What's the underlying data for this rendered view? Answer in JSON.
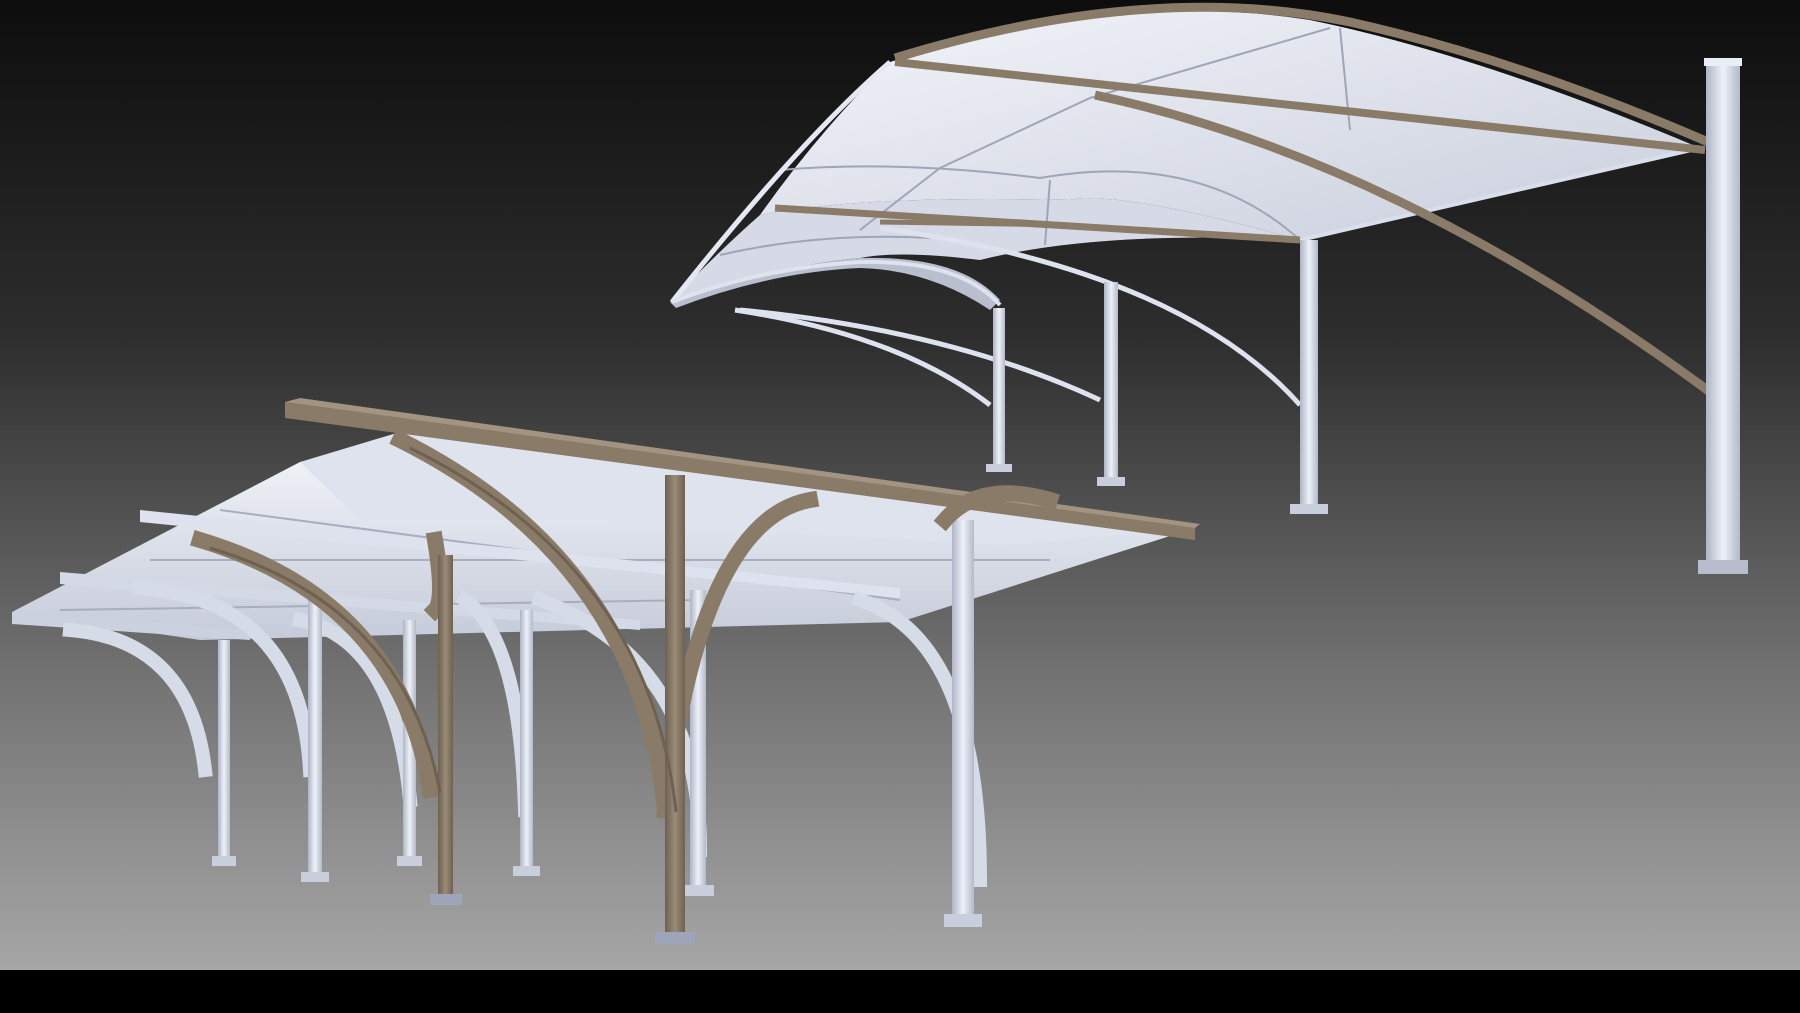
{
  "scene": {
    "background_top": "#0d0d0d",
    "background_bottom": "#a6a6a6",
    "letterbox_color": "#000000",
    "objects": [
      {
        "name": "cantilever-canopy",
        "description_key": "membrane-shade-canopy-curved-arches"
      },
      {
        "name": "arched-carport-canopy",
        "description_key": "flat-roof-canopy-arched-brackets"
      }
    ]
  },
  "materials": {
    "frame_color": "#8a7b68",
    "frame_dark": "#5e5142",
    "frame_light": "#a39481",
    "membrane_color": "#e6eaf2",
    "membrane_shade": "#c5cad8",
    "white_steel": "#dde2ee",
    "white_steel_shade": "#a7adc0"
  }
}
